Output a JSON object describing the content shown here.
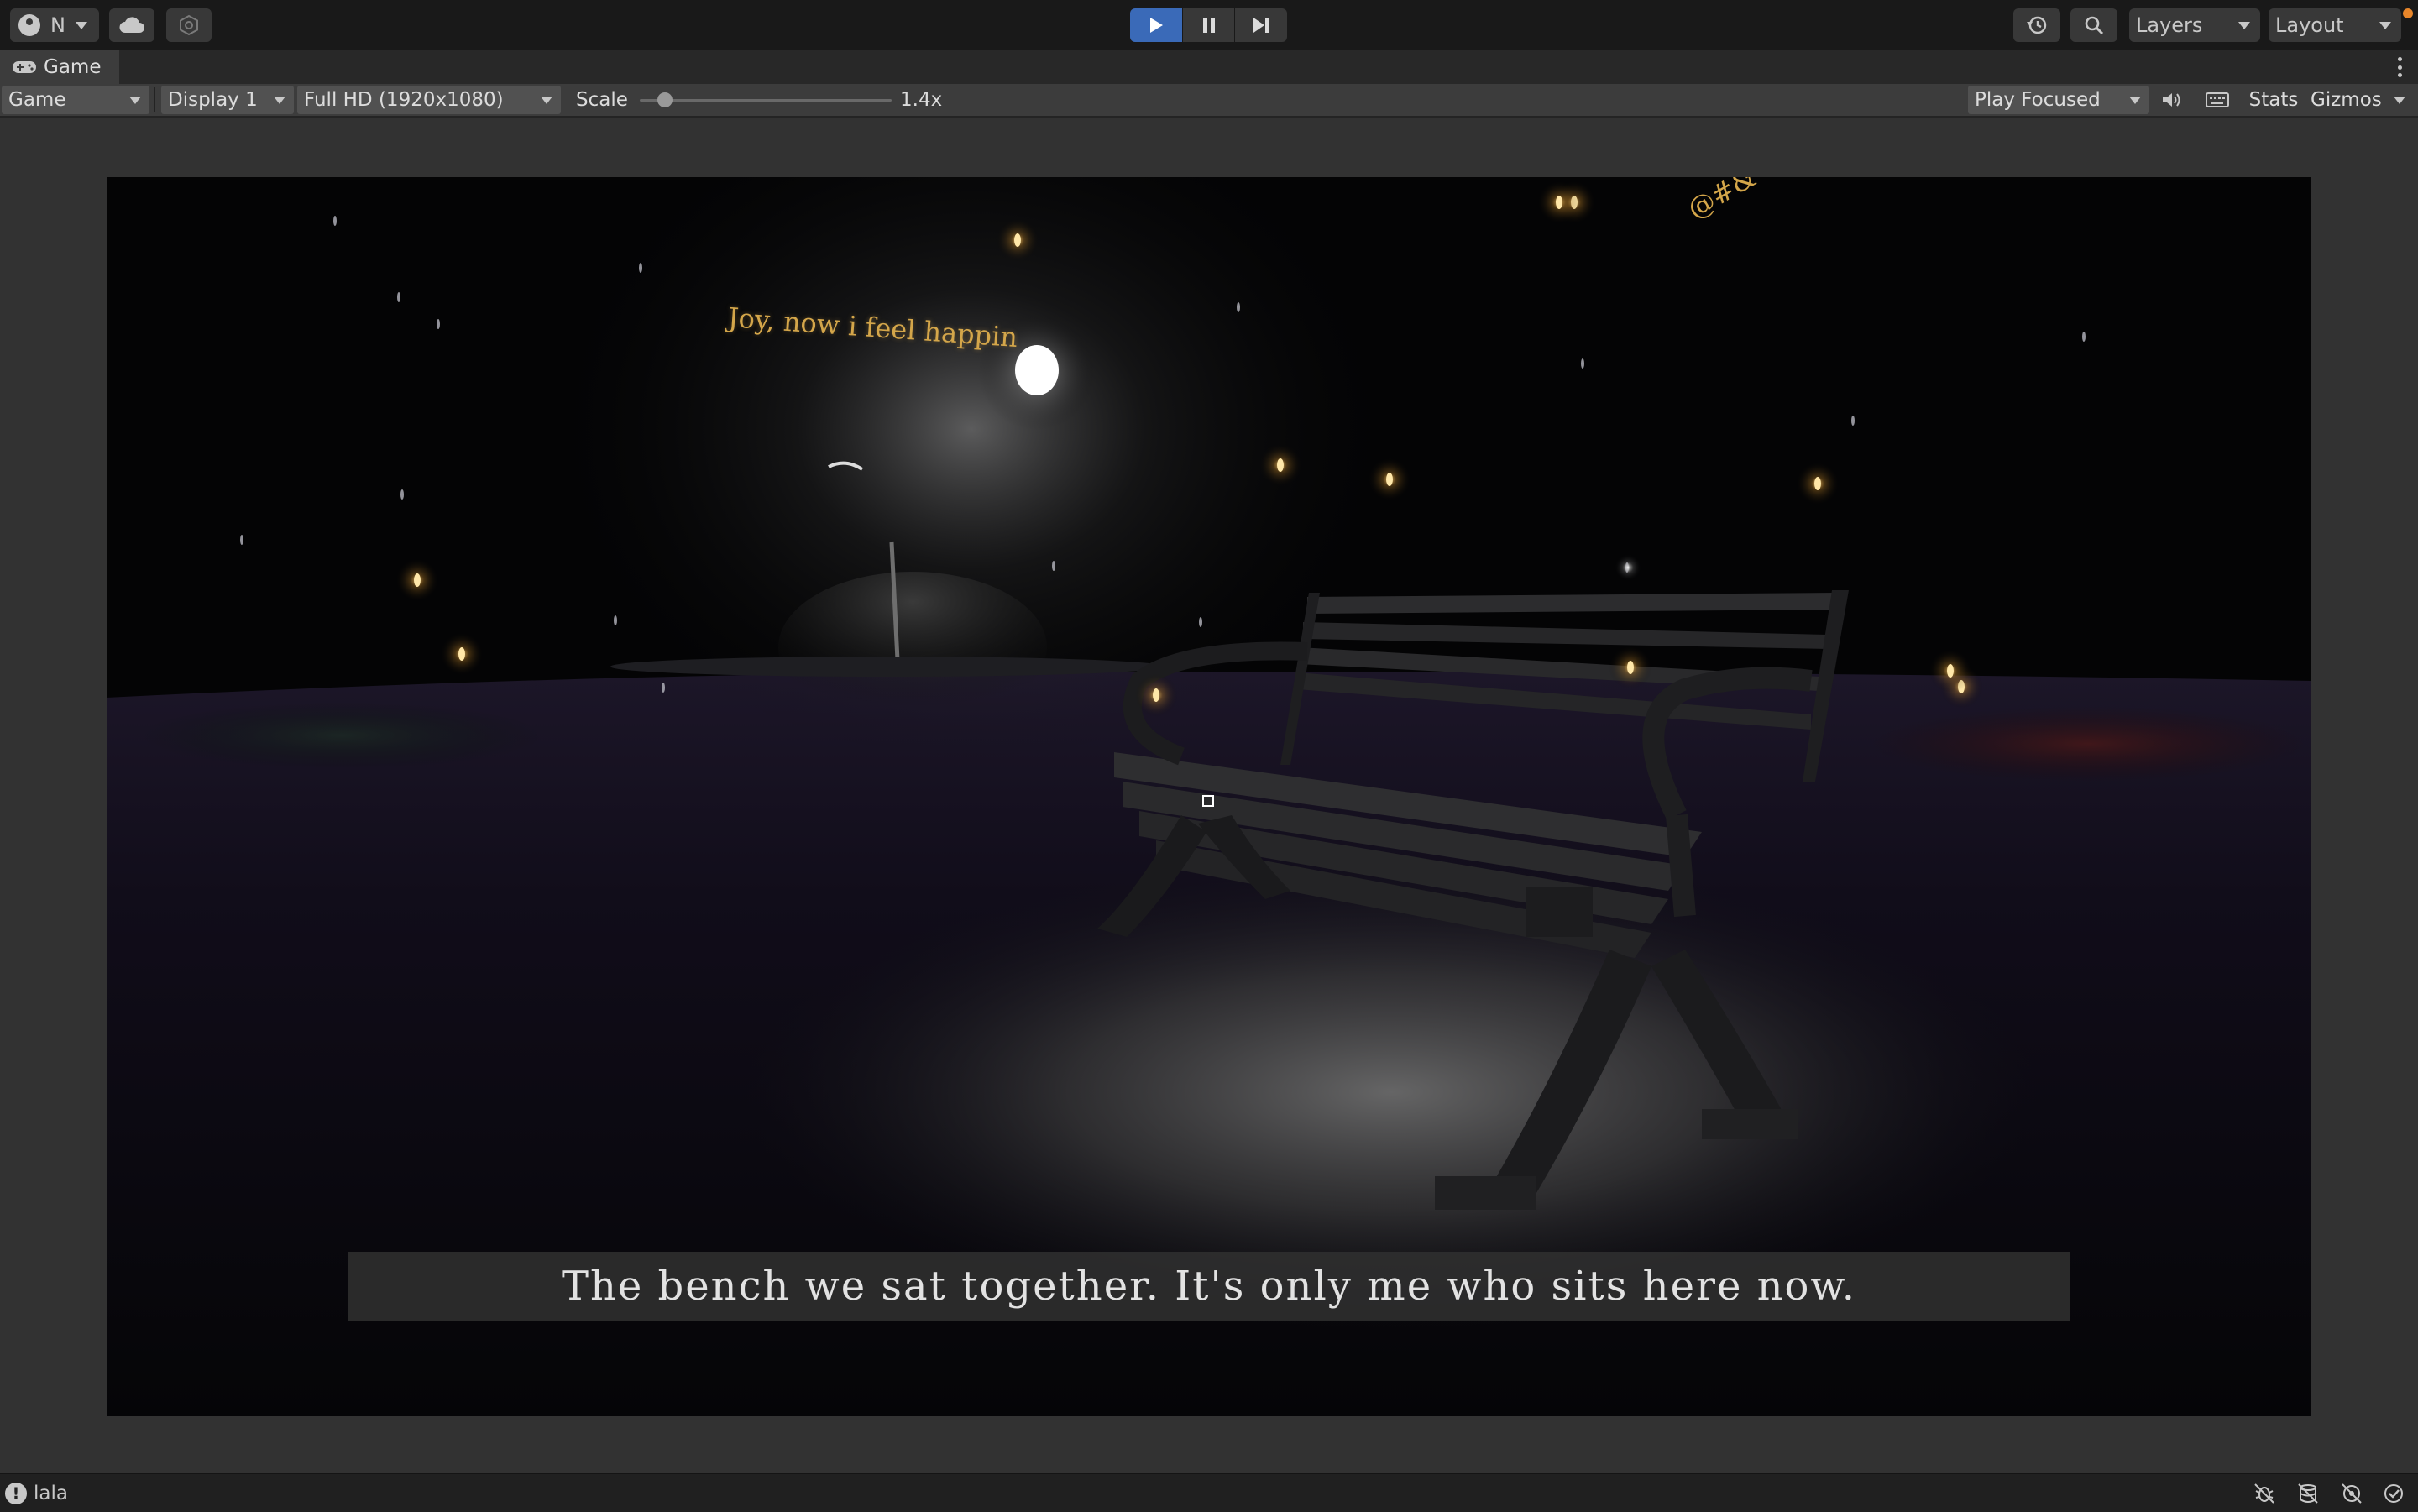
{
  "topbar": {
    "account_initial": "N",
    "account_icon": "account-icon",
    "cloud_icon": "cloud-icon",
    "collab_icon": "collab-icon",
    "play_icon": "play-icon",
    "pause_icon": "pause-icon",
    "step_icon": "step-icon",
    "history_icon": "history-icon",
    "search_icon": "search-icon",
    "layers_label": "Layers",
    "layout_label": "Layout",
    "play_accent": "#3a6ab8",
    "notification_color": "#e8862a"
  },
  "tab": {
    "label": "Game",
    "icon": "gamepad-icon"
  },
  "toolbar": {
    "view_mode": "Game",
    "display": "Display 1",
    "resolution": "Full HD (1920x1080)",
    "scale_label": "Scale",
    "scale_value": "1.4x",
    "scale_level": 0.1,
    "play_mode": "Play Focused",
    "mute_icon": "speaker-icon",
    "keyboard_icon": "keyboard-icon",
    "stats_label": "Stats",
    "gizmos_label": "Gizmos"
  },
  "game": {
    "floating_text": "Joy, now i feel happin",
    "floating_symbols": "@#&",
    "subtitle": "The bench we sat together. It's only me who sits here now.",
    "floating_text_color": "#d4a64a"
  },
  "statusbar": {
    "icon": "!",
    "message": "lala",
    "icons": [
      "debug-icon",
      "cache-icon",
      "network-icon",
      "check-icon"
    ]
  }
}
